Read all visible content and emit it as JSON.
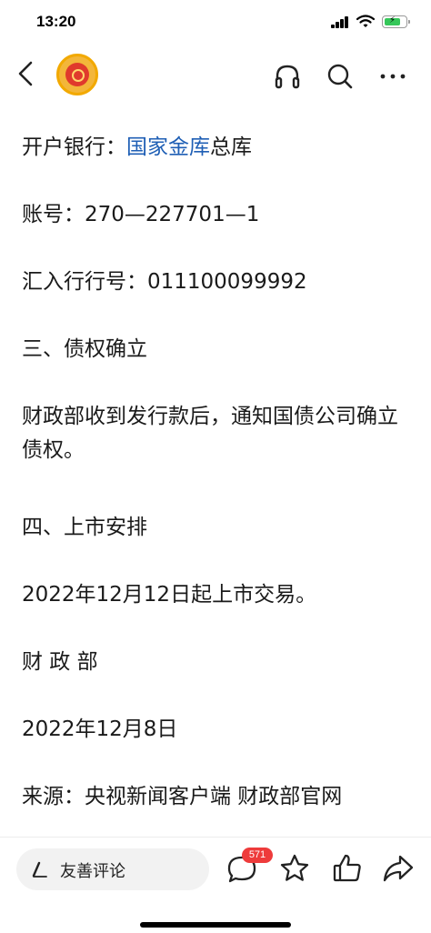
{
  "status_bar": {
    "time": "13:20"
  },
  "header": {
    "icons": [
      "back-icon",
      "account-avatar",
      "headphone-icon",
      "search-icon",
      "more-icon"
    ]
  },
  "article": {
    "bank_label": "开户银行：",
    "bank_link": "国家金库",
    "bank_suffix": "总库",
    "account": "账号：270—227701—1",
    "routing": "汇入行行号：011100099992",
    "section3_title": "三、债权确立",
    "section3_body": "财政部收到发行款后，通知国债公司确立债权。",
    "section4_title": "四、上市安排",
    "section4_body": "2022年12月12日起上市交易。",
    "issuer": "财 政 部",
    "date": "2022年12月8日",
    "source": "来源：央视新闻客户端 财政部官网"
  },
  "bottom_bar": {
    "comment_placeholder": "友善评论",
    "comment_count": "571"
  },
  "colors": {
    "link": "#1f5fb5",
    "badge": "#ee3b3b",
    "battery": "#35c759"
  }
}
